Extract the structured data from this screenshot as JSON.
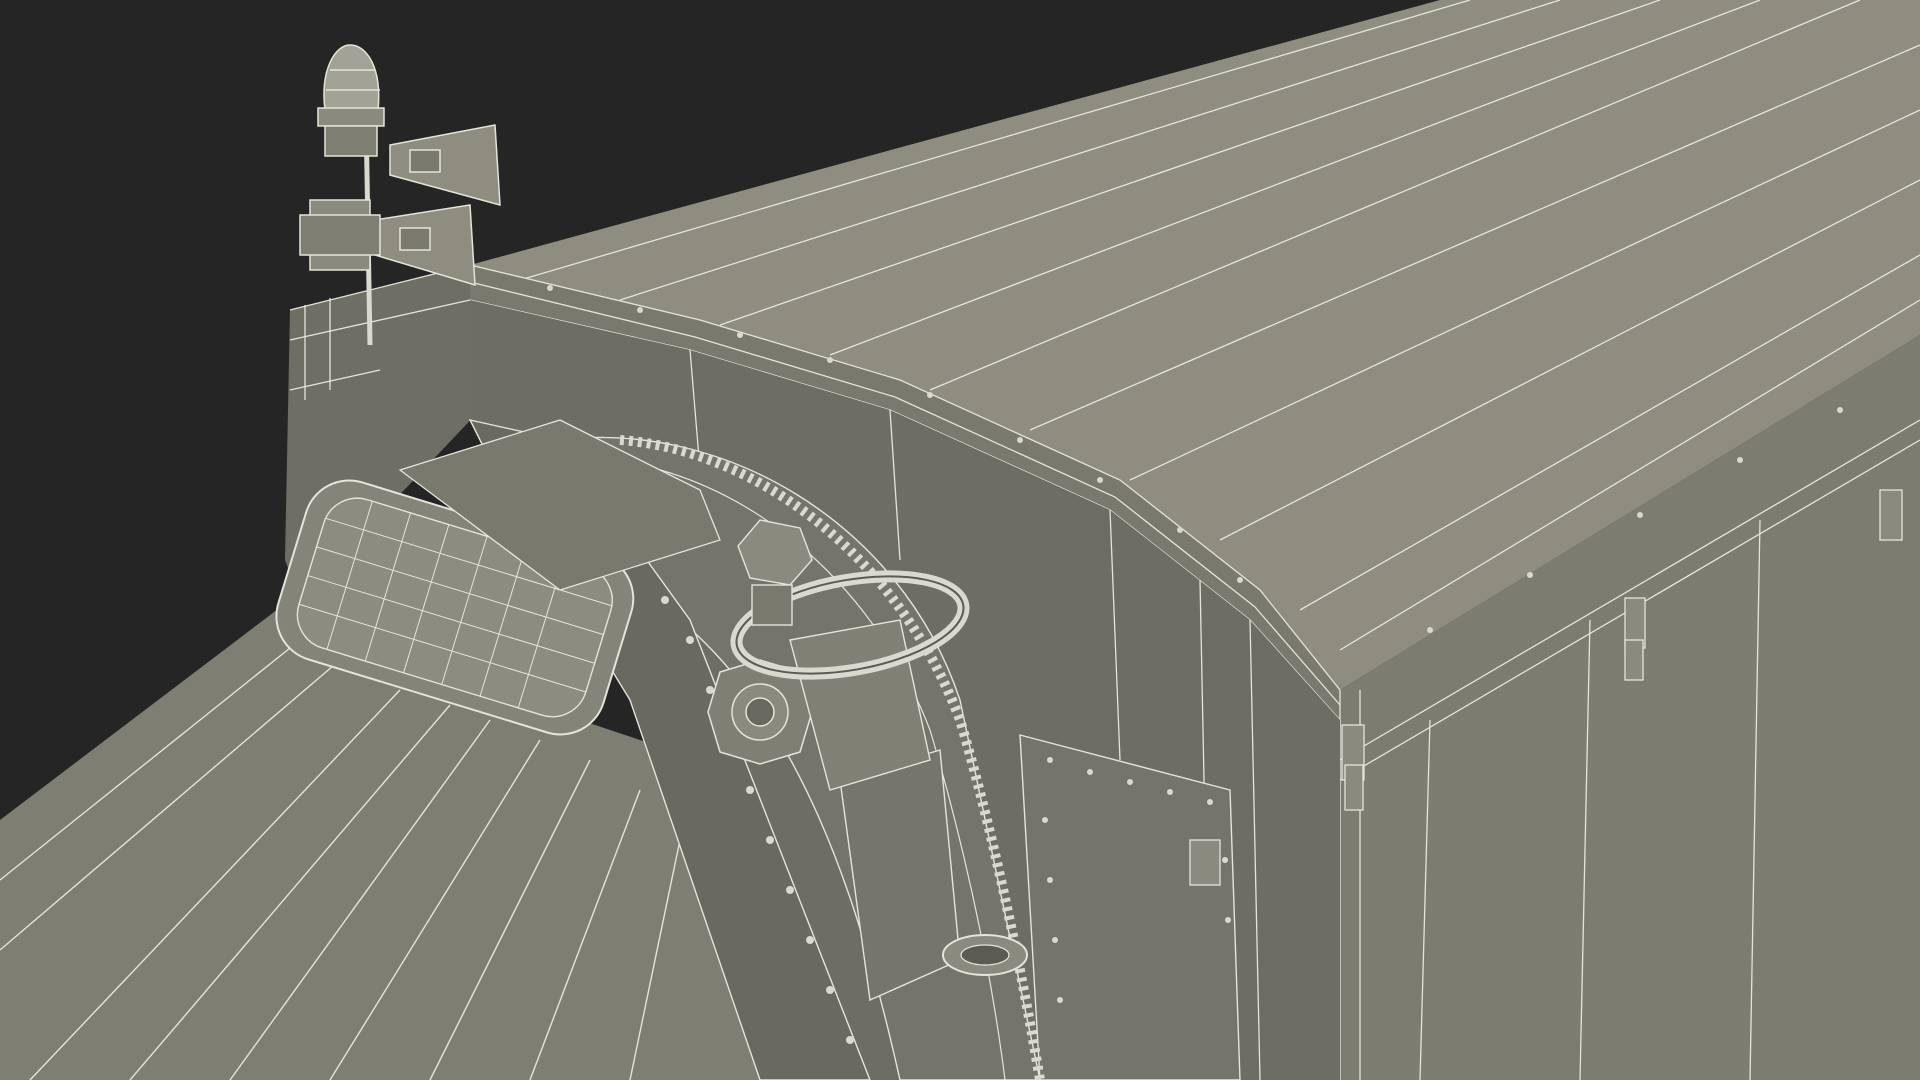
{
  "image": {
    "subject": "wireframe-render",
    "colors": {
      "background": "#252525",
      "surface_light": "#8e8d80",
      "surface_mid": "#7f7e72",
      "surface_dark": "#6b6a60",
      "surface_shadow": "#5c5b52",
      "wire": "#e4e4da",
      "wire_faint": "#c9c9bd"
    },
    "icons": [
      "siren-icon",
      "horn-icon",
      "beacon-icon",
      "gear-icon",
      "chain-icon",
      "hatch-icon",
      "bracket-icon"
    ]
  }
}
